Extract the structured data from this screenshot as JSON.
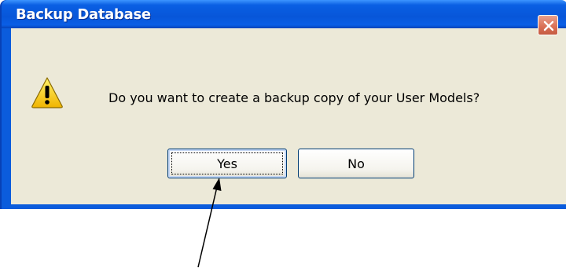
{
  "dialog": {
    "title": "Backup Database",
    "message": "Do you want to create a backup copy of your User Models?",
    "buttons": {
      "yes_label": "Yes",
      "no_label": "No"
    },
    "icons": {
      "warning": "warning-icon",
      "close": "close-icon"
    }
  },
  "annotation": {
    "arrow": "pointer-arrow"
  },
  "colors": {
    "titlebar": "#0a5fe3",
    "client_background": "#ece9d8",
    "close_button": "#d96f55",
    "warning_yellow": "#ffd800"
  }
}
